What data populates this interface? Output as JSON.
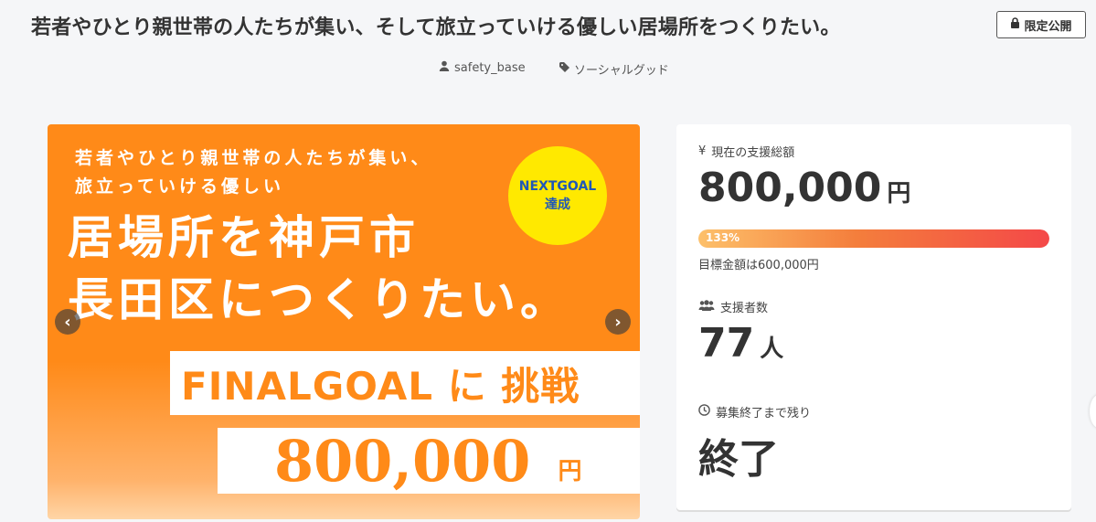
{
  "header": {
    "title": "若者やひとり親世帯の人たちが集い、そして旅立っていける優しい居場所をつくりたい。",
    "badge": "限定公開",
    "owner": "safety_base",
    "category": "ソーシャルグッド"
  },
  "hero": {
    "sub_line1": "若者やひとり親世帯の人たちが集い、",
    "sub_line2": "旅立っていける優しい",
    "big_line1": "居場所を神戸市",
    "big_line2": "長田区につくりたい。",
    "next_line1": "NEXTGOAL",
    "next_line2": "達成",
    "final": "FINALGOAL に 挑戦",
    "amount": "800,000",
    "amount_unit": "円",
    "prev_arrow": "‹",
    "next_arrow": "›"
  },
  "stats": {
    "funds_label": "現在の支援総額",
    "funds_icon": "¥",
    "funds_value": "800,000",
    "funds_unit": "円",
    "progress_percent": 133,
    "progress_label": "133%",
    "target_text": "目標金額は600,000円",
    "supporters_label": "支援者数",
    "supporters_value": "77",
    "supporters_unit": "人",
    "remaining_label": "募集終了まで残り",
    "remaining_value": "終了"
  },
  "colors": {
    "accent": "#ff8a18",
    "next_badge": "#ffe900",
    "next_text": "#1f57b8"
  }
}
